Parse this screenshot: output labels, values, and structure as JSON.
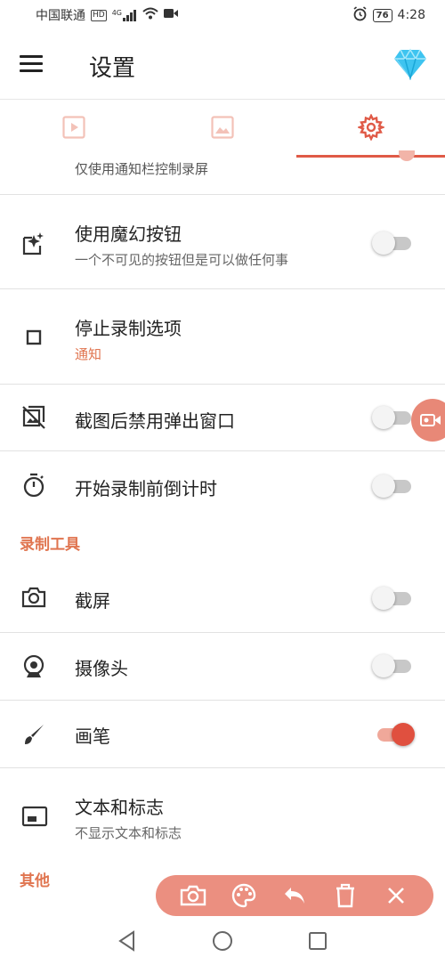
{
  "status_bar": {
    "carrier": "中国联通",
    "hd_badge": "HD",
    "network": "4G",
    "battery": "76",
    "time": "4:28"
  },
  "toolbar": {
    "title": "设置",
    "menu_icon": "hamburger-menu-icon",
    "premium_icon": "diamond-icon"
  },
  "tabs": [
    {
      "icon": "video-icon",
      "active": false
    },
    {
      "icon": "image-icon",
      "active": false
    },
    {
      "icon": "gear-icon",
      "active": true
    }
  ],
  "settings": {
    "partial_sub": "仅使用通知栏控制录屏",
    "magic_button": {
      "label": "使用魔幻按钮",
      "sub": "一个不可见的按钮但是可以做任何事",
      "on": false
    },
    "stop_options": {
      "label": "停止录制选项",
      "sub": "通知"
    },
    "disable_popup": {
      "label": "截图后禁用弹出窗口",
      "on": false
    },
    "countdown": {
      "label": "开始录制前倒计时",
      "on": false
    }
  },
  "tools": {
    "header": "录制工具",
    "screenshot": {
      "label": "截屏",
      "on": false
    },
    "camera": {
      "label": "摄像头",
      "on": false
    },
    "brush": {
      "label": "画笔",
      "on": true
    },
    "text_logo": {
      "label": "文本和标志",
      "sub": "不显示文本和标志"
    }
  },
  "other": {
    "header": "其他"
  },
  "colors": {
    "accent": "#e05a47",
    "accent_light": "#eb8f80",
    "section": "#e07550"
  },
  "bottom_toolbar": [
    "camera-icon",
    "palette-icon",
    "undo-icon",
    "trash-icon",
    "close-icon"
  ],
  "nav_bar": [
    "back-icon",
    "home-icon",
    "recents-icon"
  ]
}
